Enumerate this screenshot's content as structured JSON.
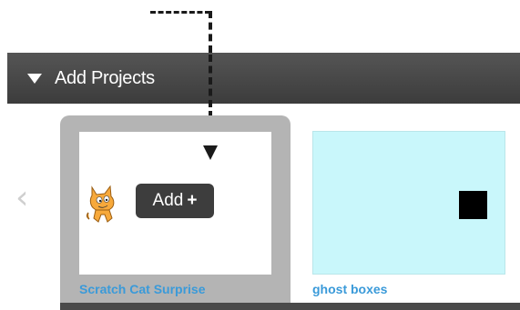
{
  "section": {
    "title": "Add Projects"
  },
  "projects": [
    {
      "title": "Scratch Cat Surprise",
      "add_label": "Add",
      "add_symbol": "+"
    },
    {
      "title": "ghost boxes"
    }
  ],
  "colors": {
    "header_bg": "#464646",
    "selected_card_bg": "#b4b4b4",
    "link_blue": "#3a9ad9",
    "ghost_boxes_bg": "#c9f7fb"
  }
}
